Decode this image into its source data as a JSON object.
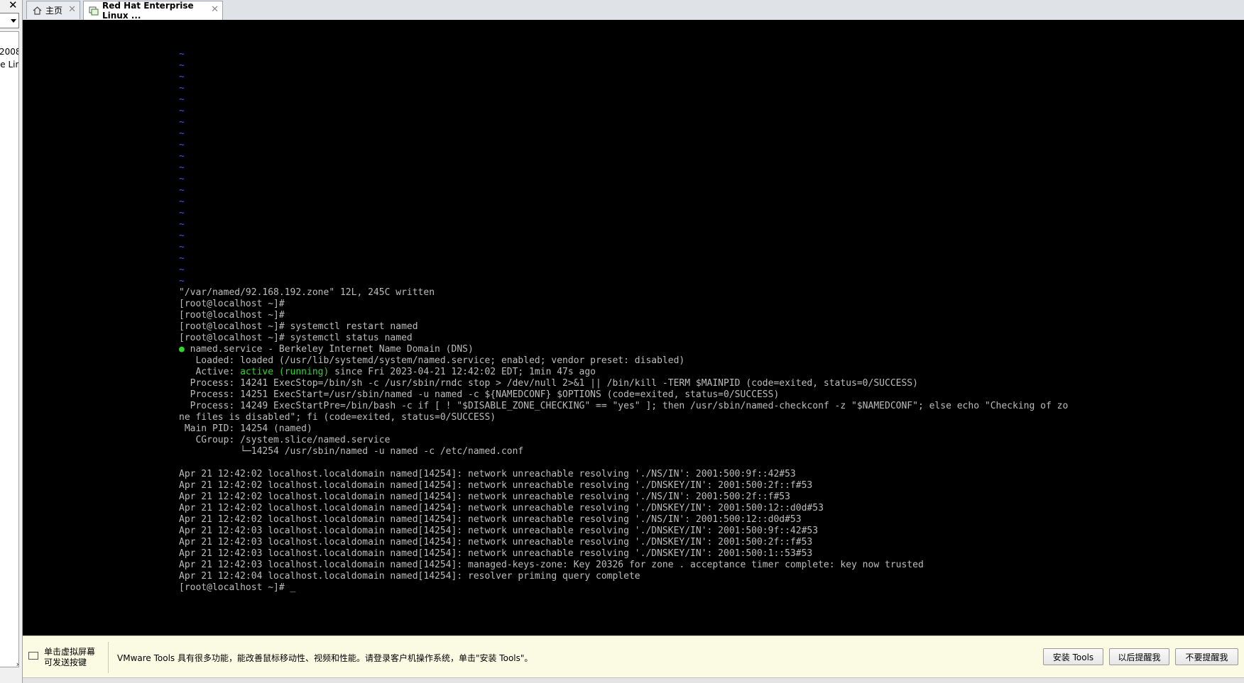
{
  "left_panel": {
    "close": "✕",
    "items": [
      "2008",
      "se Lin"
    ],
    "scroll": "›"
  },
  "tabs": [
    {
      "label": "主页",
      "close": "✕"
    },
    {
      "label": "Red Hat Enterprise Linux ...",
      "close": "✕"
    }
  ],
  "terminal": {
    "tilde": "~",
    "written": "\"/var/named/92.168.192.zone\" 12L, 245C written",
    "prompt1": "[root@localhost ~]#",
    "prompt2": "[root@localhost ~]#",
    "cmd_restart": "[root@localhost ~]# systemctl restart named",
    "cmd_status": "[root@localhost ~]# systemctl status named",
    "status_bullet": "●",
    "unit_line": " named.service - Berkeley Internet Name Domain (DNS)",
    "loaded_line": "   Loaded: loaded (/usr/lib/systemd/system/named.service; enabled; vendor preset: disabled)",
    "active_label": "   Active: ",
    "active_state": "active (running)",
    "active_rest": " since Fri 2023-04-21 12:42:02 EDT; 1min 47s ago",
    "process1": "  Process: 14241 ExecStop=/bin/sh -c /usr/sbin/rndc stop > /dev/null 2>&1 || /bin/kill -TERM $MAINPID (code=exited, status=0/SUCCESS)",
    "process2": "  Process: 14251 ExecStart=/usr/sbin/named -u named -c ${NAMEDCONF} $OPTIONS (code=exited, status=0/SUCCESS)",
    "process3": "  Process: 14249 ExecStartPre=/bin/bash -c if [ ! \"$DISABLE_ZONE_CHECKING\" == \"yes\" ]; then /usr/sbin/named-checkconf -z \"$NAMEDCONF\"; else echo \"Checking of zo",
    "process3_cont": "ne files is disabled\"; fi (code=exited, status=0/SUCCESS)",
    "main_pid": " Main PID: 14254 (named)",
    "cgroup": "   CGroup: /system.slice/named.service",
    "cgroup_child": "           └─14254 /usr/sbin/named -u named -c /etc/named.conf",
    "logs": [
      "Apr 21 12:42:02 localhost.localdomain named[14254]: network unreachable resolving './NS/IN': 2001:500:9f::42#53",
      "Apr 21 12:42:02 localhost.localdomain named[14254]: network unreachable resolving './DNSKEY/IN': 2001:500:2f::f#53",
      "Apr 21 12:42:02 localhost.localdomain named[14254]: network unreachable resolving './NS/IN': 2001:500:2f::f#53",
      "Apr 21 12:42:02 localhost.localdomain named[14254]: network unreachable resolving './DNSKEY/IN': 2001:500:12::d0d#53",
      "Apr 21 12:42:02 localhost.localdomain named[14254]: network unreachable resolving './NS/IN': 2001:500:12::d0d#53",
      "Apr 21 12:42:03 localhost.localdomain named[14254]: network unreachable resolving './DNSKEY/IN': 2001:500:9f::42#53",
      "Apr 21 12:42:03 localhost.localdomain named[14254]: network unreachable resolving './DNSKEY/IN': 2001:500:2f::f#53",
      "Apr 21 12:42:03 localhost.localdomain named[14254]: network unreachable resolving './DNSKEY/IN': 2001:500:1::53#53",
      "Apr 21 12:42:03 localhost.localdomain named[14254]: managed-keys-zone: Key 20326 for zone . acceptance timer complete: key now trusted",
      "Apr 21 12:42:04 localhost.localdomain named[14254]: resolver priming query complete"
    ],
    "final_prompt": "[root@localhost ~]# ",
    "cursor": "_"
  },
  "notify": {
    "hint": "单击虚拟屏幕\n可发送按键",
    "message": "VMware Tools 具有很多功能，能改善鼠标移动性、视频和性能。请登录客户机操作系统，单击\"安装 Tools\"。",
    "install_button": "安装 Tools",
    "later_button": "以后提醒我",
    "never_button": "不要提醒我"
  },
  "colors": {
    "terminal_bg": "#000000",
    "terminal_fg": "#bcbcbc",
    "tilde": "#3f56e0",
    "active_green": "#2ed52e",
    "notify_bg": "#fbfbe4"
  }
}
